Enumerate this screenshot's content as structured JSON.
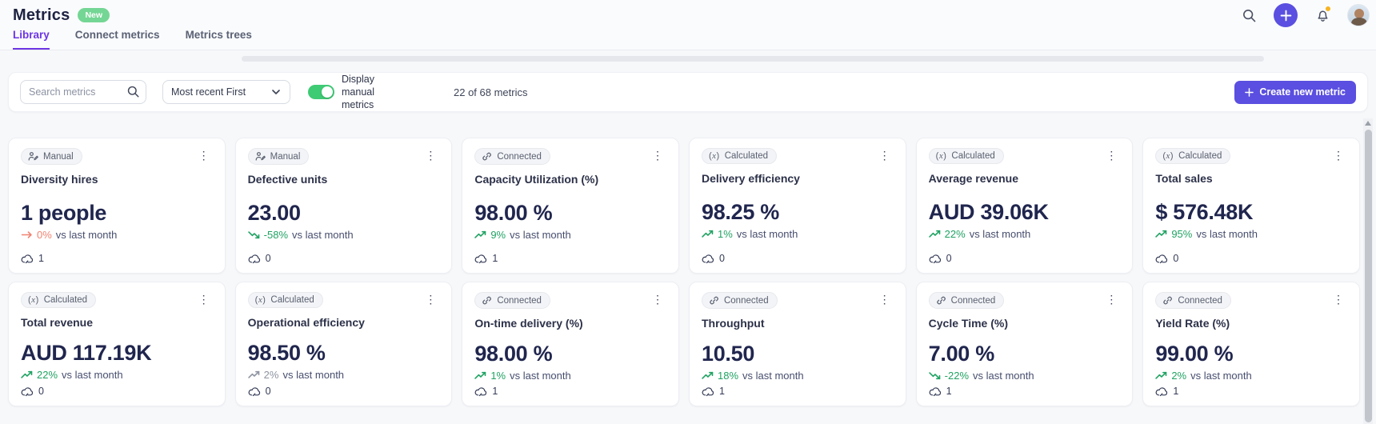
{
  "header": {
    "title": "Metrics",
    "new_badge": "New",
    "action_icons": [
      "search-icon",
      "plus-icon",
      "bell-icon",
      "avatar"
    ],
    "bell_has_dot": true
  },
  "tabs": [
    {
      "label": "Library",
      "active": true
    },
    {
      "label": "Connect metrics",
      "active": false
    },
    {
      "label": "Metrics trees",
      "active": false
    }
  ],
  "toolbar": {
    "search_placeholder": "Search metrics",
    "sort_value": "Most recent First",
    "toggle_on": true,
    "toggle_label": "Display manual metrics",
    "count_text": "22 of 68 metrics",
    "create_label": "Create new metric"
  },
  "labels": {
    "vs_text": "vs last month"
  },
  "colors": {
    "accent_purple": "#5a4fe0",
    "tab_purple": "#6d35e5",
    "green": "#21a263",
    "orange": "#ef8372",
    "gray_delta": "#8e94a1",
    "new_badge_green": "#74d694",
    "toggle_green": "#3fca74"
  },
  "cards": [
    {
      "type": "Manual",
      "icon": "manual-icon",
      "title": "Diversity hires",
      "value": "1 people",
      "trend": "flat",
      "trend_color": "orange",
      "delta": "0%",
      "sources": "1"
    },
    {
      "type": "Manual",
      "icon": "manual-icon",
      "title": "Defective units",
      "value": "23.00",
      "trend": "down",
      "trend_color": "green",
      "delta": "-58%",
      "sources": "0"
    },
    {
      "type": "Connected",
      "icon": "link-icon",
      "title": "Capacity Utilization (%)",
      "value": "98.00 %",
      "trend": "up",
      "trend_color": "green",
      "delta": "9%",
      "sources": "1"
    },
    {
      "type": "Calculated",
      "icon": "fx-icon",
      "title": "Delivery efficiency",
      "value": "98.25 %",
      "trend": "up",
      "trend_color": "green",
      "delta": "1%",
      "sources": "0"
    },
    {
      "type": "Calculated",
      "icon": "fx-icon",
      "title": "Average revenue",
      "value": "AUD 39.06K",
      "trend": "up",
      "trend_color": "green",
      "delta": "22%",
      "sources": "0"
    },
    {
      "type": "Calculated",
      "icon": "fx-icon",
      "title": "Total sales",
      "value": "$ 576.48K",
      "trend": "up",
      "trend_color": "green",
      "delta": "95%",
      "sources": "0"
    },
    {
      "type": "Calculated",
      "icon": "fx-icon",
      "title": "Total revenue",
      "value": "AUD 117.19K",
      "trend": "up",
      "trend_color": "green",
      "delta": "22%",
      "sources": "0"
    },
    {
      "type": "Calculated",
      "icon": "fx-icon",
      "title": "Operational efficiency",
      "value": "98.50 %",
      "trend": "up",
      "trend_color": "gray",
      "delta": "2%",
      "sources": "0"
    },
    {
      "type": "Connected",
      "icon": "link-icon",
      "title": "On-time delivery (%)",
      "value": "98.00 %",
      "trend": "up",
      "trend_color": "green",
      "delta": "1%",
      "sources": "1"
    },
    {
      "type": "Connected",
      "icon": "link-icon",
      "title": "Throughput",
      "value": "10.50",
      "trend": "up",
      "trend_color": "green",
      "delta": "18%",
      "sources": "1"
    },
    {
      "type": "Connected",
      "icon": "link-icon",
      "title": "Cycle Time (%)",
      "value": "7.00 %",
      "trend": "down",
      "trend_color": "green",
      "delta": "-22%",
      "sources": "1"
    },
    {
      "type": "Connected",
      "icon": "link-icon",
      "title": "Yield Rate (%)",
      "value": "99.00 %",
      "trend": "up",
      "trend_color": "green",
      "delta": "2%",
      "sources": "1"
    }
  ]
}
